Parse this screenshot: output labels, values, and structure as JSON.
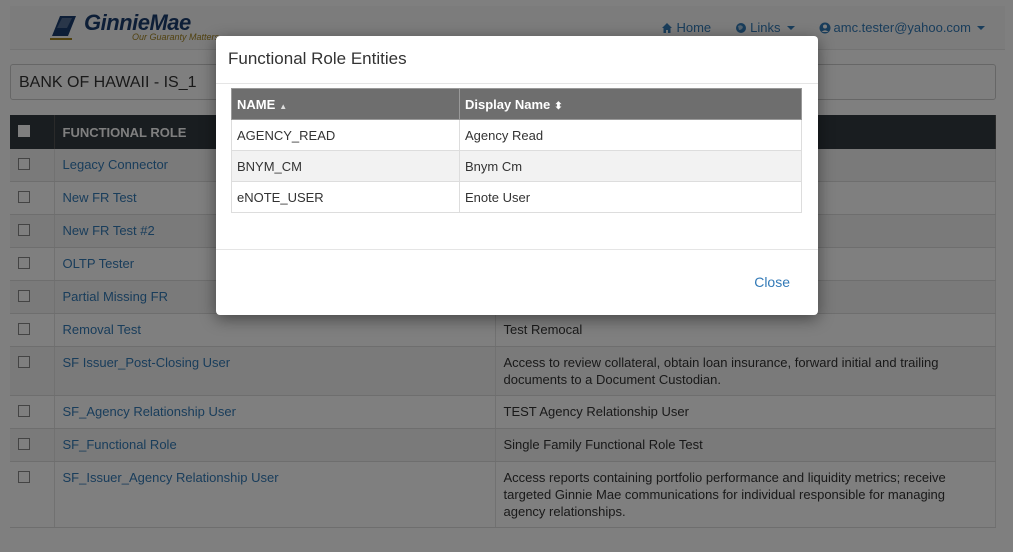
{
  "nav": {
    "brand_name": "GinnieMae",
    "brand_tagline": "Our Guaranty Matters",
    "home_label": "Home",
    "links_label": "Links",
    "user_label": "amc.tester@yahoo.com"
  },
  "entity": {
    "title": "BANK OF HAWAII - IS_1"
  },
  "roles_table": {
    "header_role": "FUNCTIONAL ROLE",
    "rows": [
      {
        "name": "Legacy Connector",
        "desc": ""
      },
      {
        "name": "New FR Test",
        "desc": ""
      },
      {
        "name": "New FR Test #2",
        "desc": ""
      },
      {
        "name": "OLTP Tester",
        "desc": ""
      },
      {
        "name": "Partial Missing FR",
        "desc": ""
      },
      {
        "name": "Removal Test",
        "desc": "Test Remocal"
      },
      {
        "name": "SF Issuer_Post-Closing User",
        "desc": "Access to review collateral, obtain loan insurance, forward initial and trailing documents to a Document Custodian."
      },
      {
        "name": "SF_Agency Relationship User",
        "desc": "TEST Agency Relationship User"
      },
      {
        "name": "SF_Functional Role",
        "desc": "Single Family Functional Role Test"
      },
      {
        "name": "SF_Issuer_Agency Relationship User",
        "desc": "Access reports containing portfolio performance and liquidity metrics; receive targeted Ginnie Mae communications for individual responsible for managing agency relationships."
      }
    ]
  },
  "modal": {
    "title": "Functional Role Entities",
    "col_name": "NAME",
    "col_display": "Display Name",
    "rows": [
      {
        "name": "AGENCY_READ",
        "display": "Agency Read"
      },
      {
        "name": "BNYM_CM",
        "display": "Bnym Cm"
      },
      {
        "name": "eNOTE_USER",
        "display": "Enote User"
      }
    ],
    "close_label": "Close"
  },
  "colors": {
    "link": "#337ab7",
    "header_dark": "#333a40",
    "modal_header": "#6e6e6e",
    "brand_navy": "#1a3d6e",
    "brand_gold": "#a38420"
  }
}
